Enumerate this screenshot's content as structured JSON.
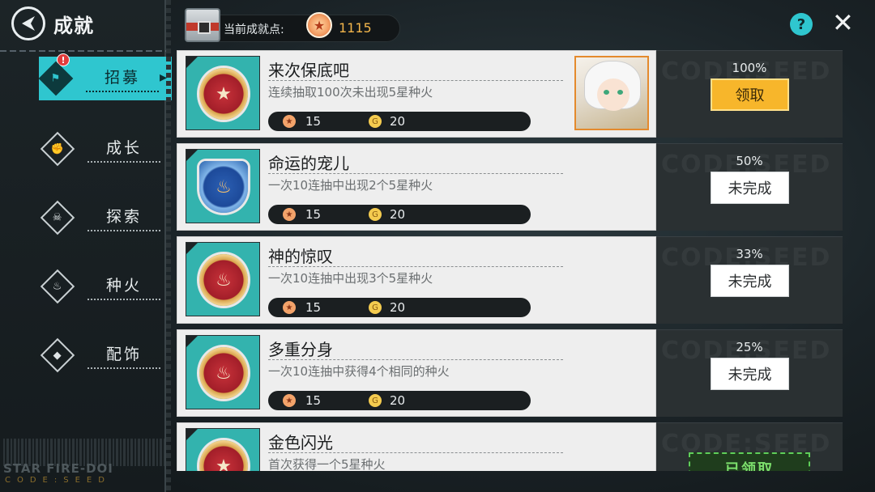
{
  "header": {
    "title": "成就",
    "points_label": "当前成就点:",
    "points_value": "1115"
  },
  "sidebar": {
    "items": [
      {
        "label": "招募",
        "icon": "recruit-icon",
        "glyph": "⚑",
        "active": true,
        "alert": "!"
      },
      {
        "label": "成长",
        "icon": "growth-icon",
        "glyph": "✊",
        "active": false
      },
      {
        "label": "探索",
        "icon": "explore-icon",
        "glyph": "☠",
        "active": false
      },
      {
        "label": "种火",
        "icon": "fire-icon",
        "glyph": "♨",
        "active": false
      },
      {
        "label": "配饰",
        "icon": "accessory-icon",
        "glyph": "◆",
        "active": false
      }
    ],
    "brand_line1": "STAR FIRE-DOI",
    "brand_line2": "CODE:SEED"
  },
  "achievements": [
    {
      "title": "来次保底吧",
      "desc": "连续抽取100次未出现5星种火",
      "reward_a": "15",
      "reward_b": "20",
      "percent": "100%",
      "action": "领取",
      "state": "claim"
    },
    {
      "title": "命运的宠儿",
      "desc": "一次10连抽中出现2个5星种火",
      "reward_a": "15",
      "reward_b": "20",
      "percent": "50%",
      "action": "未完成",
      "state": "todo"
    },
    {
      "title": "神的惊叹",
      "desc": "一次10连抽中出现3个5星种火",
      "reward_a": "15",
      "reward_b": "20",
      "percent": "33%",
      "action": "未完成",
      "state": "todo"
    },
    {
      "title": "多重分身",
      "desc": "一次10连抽中获得4个相同的种火",
      "reward_a": "15",
      "reward_b": "20",
      "percent": "25%",
      "action": "未完成",
      "state": "todo"
    },
    {
      "title": "金色闪光",
      "desc": "首次获得一个5星种火",
      "reward_a": "",
      "reward_b": "",
      "percent": "",
      "action": "已领取",
      "state": "done"
    }
  ],
  "colors": {
    "accent": "#2fc6cf",
    "claim": "#f7b62b",
    "done": "#5fcf59"
  }
}
